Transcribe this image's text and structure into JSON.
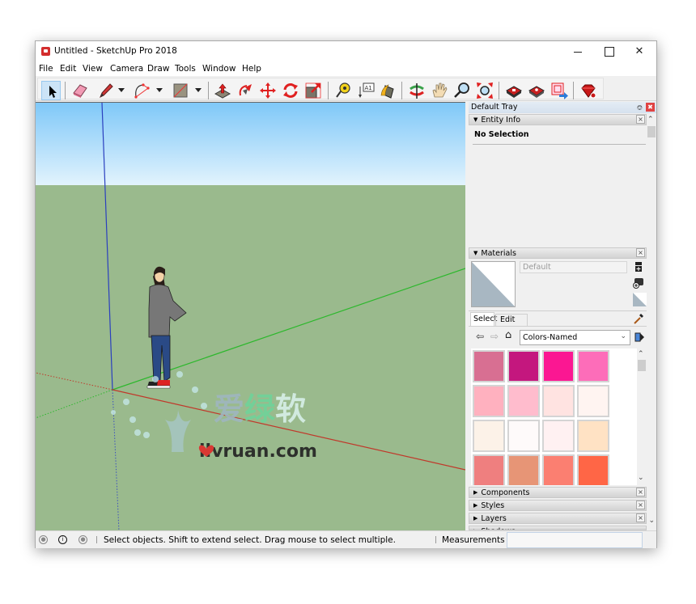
{
  "window": {
    "title": "Untitled - SketchUp Pro 2018",
    "controls": {
      "minimize": "minimize",
      "maximize": "maximize",
      "close": "✕"
    }
  },
  "menu": [
    "File",
    "Edit",
    "View",
    "Camera",
    "Draw",
    "Tools",
    "Window",
    "Help"
  ],
  "toolbar": {
    "tools": [
      {
        "name": "select-tool",
        "icon": "arrow-cursor-icon",
        "active": true
      },
      {
        "name": "eraser-tool",
        "icon": "eraser-icon"
      },
      {
        "name": "line-tool",
        "icon": "pencil-icon",
        "dropdown": true
      },
      {
        "name": "arc-tool",
        "icon": "arc-icon",
        "dropdown": true
      },
      {
        "name": "shapes-tool",
        "icon": "rectangle-icon",
        "dropdown": true
      },
      {
        "name": "push-pull-tool",
        "icon": "push-pull-icon"
      },
      {
        "name": "follow-me-tool",
        "icon": "follow-me-icon"
      },
      {
        "name": "move-tool",
        "icon": "move-icon"
      },
      {
        "name": "rotate-tool",
        "icon": "rotate-icon"
      },
      {
        "name": "scale-tool",
        "icon": "scale-icon"
      },
      {
        "name": "tape-measure-tool",
        "icon": "tape-measure-icon"
      },
      {
        "name": "text-tool",
        "icon": "text-icon",
        "label": "A1"
      },
      {
        "name": "paint-bucket-tool",
        "icon": "paint-bucket-icon"
      },
      {
        "name": "orbit-tool",
        "icon": "orbit-icon"
      },
      {
        "name": "pan-tool",
        "icon": "hand-icon"
      },
      {
        "name": "zoom-tool",
        "icon": "magnifier-icon"
      },
      {
        "name": "zoom-extents-tool",
        "icon": "zoom-extents-icon"
      },
      {
        "name": "3d-warehouse",
        "icon": "warehouse-icon"
      },
      {
        "name": "extension-warehouse",
        "icon": "extension-warehouse-icon"
      },
      {
        "name": "send-to-layout",
        "icon": "layout-icon"
      },
      {
        "name": "extension-manager",
        "icon": "ruby-icon"
      }
    ]
  },
  "tray": {
    "title": "Default Tray",
    "entity_info": {
      "title": "Entity Info",
      "selection": "No Selection"
    },
    "materials": {
      "title": "Materials",
      "current_material": "Default",
      "tabs": [
        "Select",
        "Edit"
      ],
      "active_tab": "Select",
      "library": "Colors-Named",
      "swatches": [
        "#d86f92",
        "#c4177e",
        "#fb1792",
        "#fd6db9",
        "#ffb1bf",
        "#ffbccd",
        "#ffe3e1",
        "#fff4f1",
        "#fcf2e8",
        "#fefafa",
        "#fff1f2",
        "#ffe2c4",
        "#ef7f7f",
        "#e79576",
        "#fb7f71",
        "#ff6646"
      ]
    },
    "collapsed_panels": [
      "Components",
      "Styles",
      "Layers",
      "Shadows"
    ]
  },
  "statusbar": {
    "message": "Select objects. Shift to extend select. Drag mouse to select multiple.",
    "measurements_label": "Measurements",
    "measurements_value": ""
  },
  "viewport": {
    "sky_top": "#7fc8f8",
    "sky_bottom": "#e2f3fd",
    "ground": "#9aba8d",
    "watermark_cn": "爱绿软",
    "watermark_url": "ilvruan.com"
  }
}
